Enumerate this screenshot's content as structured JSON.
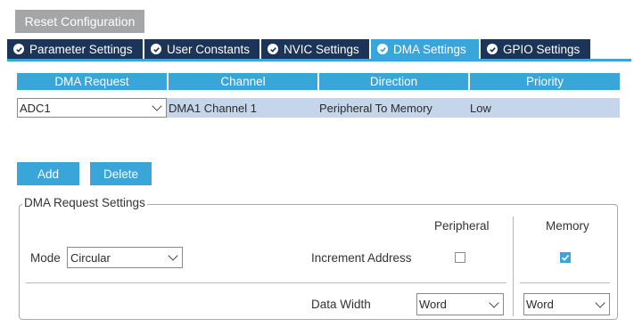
{
  "toolbar": {
    "reset_label": "Reset Configuration"
  },
  "tabs": [
    {
      "label": "Parameter Settings",
      "active": false
    },
    {
      "label": "User Constants",
      "active": false
    },
    {
      "label": "NVIC Settings",
      "active": false
    },
    {
      "label": "DMA Settings",
      "active": true
    },
    {
      "label": "GPIO Settings",
      "active": false
    }
  ],
  "dma_table": {
    "headers": [
      "DMA Request",
      "Channel",
      "Direction",
      "Priority"
    ],
    "rows": [
      {
        "request": "ADC1",
        "channel": "DMA1 Channel 1",
        "direction": "Peripheral To Memory",
        "priority": "Low"
      }
    ]
  },
  "actions": {
    "add_label": "Add",
    "delete_label": "Delete"
  },
  "settings": {
    "legend": "DMA Request Settings",
    "peripheral_label": "Peripheral",
    "memory_label": "Memory",
    "mode_label": "Mode",
    "mode_value": "Circular",
    "increment_label": "Increment Address",
    "peripheral_increment": false,
    "memory_increment": true,
    "data_width_label": "Data Width",
    "peripheral_width": "Word",
    "memory_width": "Word"
  },
  "icons": {
    "tab_status": "check-circle-icon",
    "dropdown": "chevron-down-icon",
    "checkbox_checked": "checkmark-icon"
  },
  "colors": {
    "accent": "#3aa5d9",
    "tab_dark": "#1b3457",
    "row_selected": "#c5d6ea",
    "reset_button": "#a4a6a8"
  }
}
